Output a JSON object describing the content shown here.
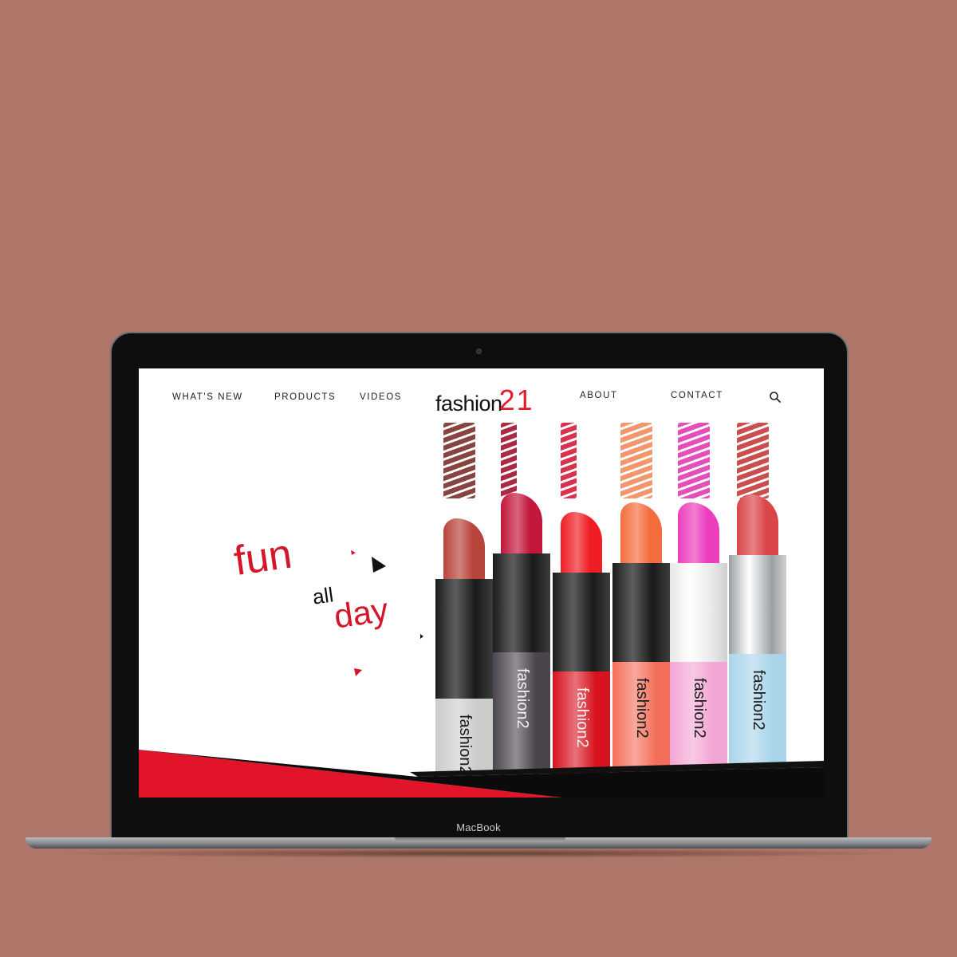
{
  "device": {
    "label": "MacBook"
  },
  "nav": {
    "items": [
      {
        "label": "WHAT'S NEW"
      },
      {
        "label": "PRODUCTS"
      },
      {
        "label": "VIDEOS"
      },
      {
        "label": "ABOUT"
      },
      {
        "label": "CONTACT"
      }
    ]
  },
  "logo": {
    "word": "fashion",
    "number": "21"
  },
  "hero": {
    "word1": "fun",
    "word2": "all",
    "word3": "day"
  },
  "products": {
    "brand_text": "fashion2",
    "lipsticks": [
      {
        "shade": "#b8453c",
        "swatch": "#7b2f2a",
        "base_color": "#c9ccc9",
        "collar": "#1b1b1b"
      },
      {
        "shade": "#c3173c",
        "swatch": "#a0122f",
        "base_color": "#4a444d",
        "collar": "#161616"
      },
      {
        "shade": "#ef1d24",
        "swatch": "#d51b3a",
        "base_color": "#d8121e",
        "collar": "#131313"
      },
      {
        "shade": "#f36d3d",
        "swatch": "#f08a5c",
        "base_color": "#f46f5a",
        "collar": "#141414"
      },
      {
        "shade": "#ec3dbd",
        "swatch": "#e23bb3",
        "base_color": "#f2a6d3",
        "collar": "#e7e7e7"
      },
      {
        "shade": "#da4548",
        "swatch": "#c43b3b",
        "base_color": "#a9d4ea",
        "collar": "#9aa0a2"
      }
    ]
  },
  "colors": {
    "accent": "#d4152a",
    "background": "#ad7668",
    "dark": "#0b0b0b"
  }
}
